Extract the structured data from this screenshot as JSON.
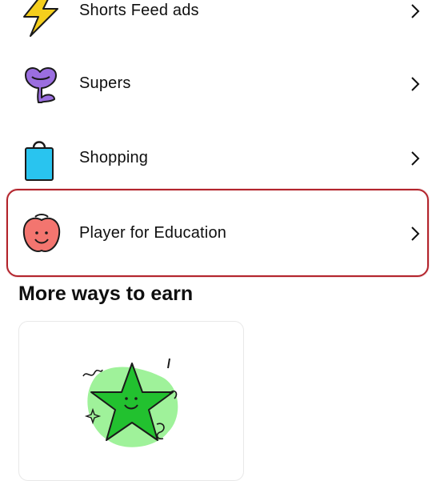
{
  "list": {
    "items": [
      {
        "label": "Shorts Feed ads",
        "icon": "lightning-bolt-icon"
      },
      {
        "label": "Supers",
        "icon": "supers-heart-icon"
      },
      {
        "label": "Shopping",
        "icon": "shopping-bag-icon"
      },
      {
        "label": "Player for Education",
        "icon": "apple-face-icon"
      }
    ]
  },
  "section": {
    "title": "More ways to earn"
  },
  "colors": {
    "highlight": "#b3242c",
    "supers": "#9b6ee0",
    "shopping": "#29c4ef",
    "education": "#f3756f",
    "bolt": "#f5cf1d",
    "star": "#22c12f"
  }
}
